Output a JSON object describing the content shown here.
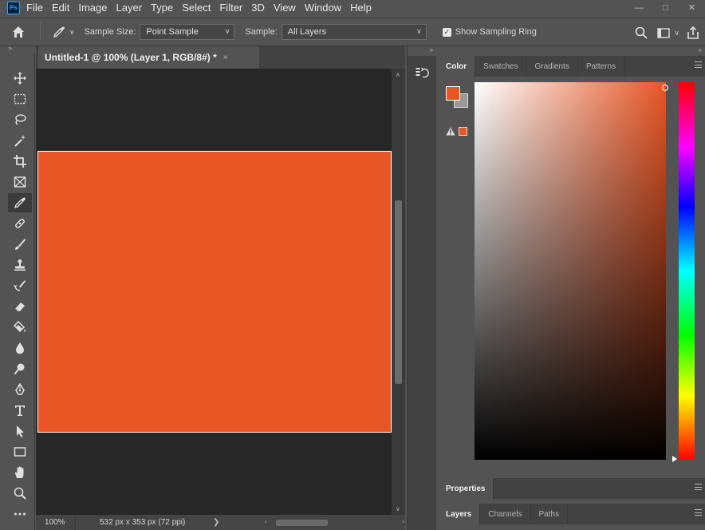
{
  "app": {
    "logo_text": "Ps"
  },
  "menu": [
    "File",
    "Edit",
    "Image",
    "Layer",
    "Type",
    "Select",
    "Filter",
    "3D",
    "View",
    "Window",
    "Help"
  ],
  "window_controls": {
    "minimize": "—",
    "maximize": "□",
    "close": "✕"
  },
  "options": {
    "sample_size_label": "Sample Size:",
    "sample_size_value": "Point Sample",
    "sample_label": "Sample:",
    "sample_value": "All Layers",
    "show_ring_label": "Show Sampling Ring",
    "show_ring_checked": true
  },
  "document": {
    "tab_title": "Untitled-1 @ 100% (Layer 1, RGB/8#) *",
    "close_glyph": "×",
    "zoom": "100%",
    "doc_info": "532 px x 353 px (72 ppi)",
    "fill_color": "#E85626"
  },
  "panels": {
    "collapse_glyph": "»",
    "color_tabs": [
      "Color",
      "Swatches",
      "Gradients",
      "Patterns"
    ],
    "active_color_tab": "Color",
    "properties_tab": "Properties",
    "lower_tabs": [
      "Layers",
      "Channels",
      "Paths"
    ],
    "active_lower_tab": "Layers",
    "foreground_color": "#E85626",
    "background_color": "#9A9A9A"
  }
}
